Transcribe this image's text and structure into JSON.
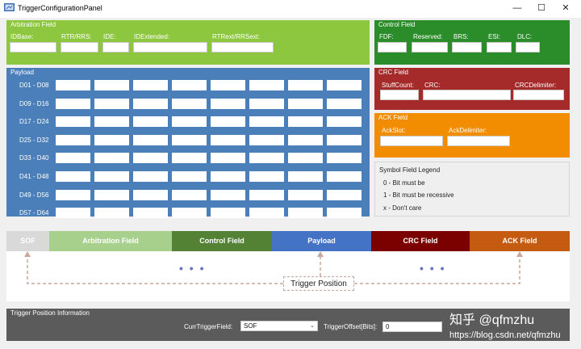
{
  "window": {
    "title": "TriggerConfigurationPanel",
    "minimize": "—",
    "maximize": "☐",
    "close": "✕"
  },
  "arbitration": {
    "title": "Arbitration Field",
    "color": "#8dc63f",
    "fields": [
      "IDBase:",
      "RTR/RRS:",
      "IDE:",
      "IDExtended:",
      "RTRext/RRSext:"
    ]
  },
  "control": {
    "title": "Control Field",
    "color": "#2a8d2a",
    "fields": [
      "FDF:",
      "Reserved:",
      "BRS:",
      "ESI:",
      "DLC:"
    ]
  },
  "payload": {
    "title": "Payload",
    "color": "#4a7fba",
    "rows": [
      "D01 - D08",
      "D09 - D16",
      "D17 - D24",
      "D25 - D32",
      "D33 - D40",
      "D41 - D48",
      "D49 - D56",
      "D57 - D64"
    ]
  },
  "crc": {
    "title": "CRC Field",
    "color": "#a52a2a",
    "fields": [
      "StuffCount:",
      "CRC:",
      "CRCDelimiter:"
    ]
  },
  "ack": {
    "title": "ACK Field",
    "color": "#f28c00",
    "fields": [
      "AckSlot:",
      "AckDelimiter:"
    ]
  },
  "legend": {
    "title": "Symbol Field Legend",
    "items": [
      "0 - Bit must be",
      "1 - Bit must be recessive",
      "x - Don't care"
    ]
  },
  "frame": {
    "segments": [
      {
        "label": "SOF",
        "bg": "#d9d9d9",
        "fg": "#ffffff"
      },
      {
        "label": "Arbitration Field",
        "bg": "#a8d08d",
        "fg": "#ffffff"
      },
      {
        "label": "Control Field",
        "bg": "#548235",
        "fg": "#ffffff"
      },
      {
        "label": "Payload",
        "bg": "#4472c4",
        "fg": "#ffffff"
      },
      {
        "label": "CRC Field",
        "bg": "#7b0000",
        "fg": "#ffffff"
      },
      {
        "label": "ACK Field",
        "bg": "#c55a11",
        "fg": "#ffffff"
      }
    ],
    "dots": "• • •",
    "trigger_position": "Trigger Position"
  },
  "trigger_info": {
    "title": "Trigger Position Information",
    "curr_label": "CurrTriggerField:",
    "curr_value": "SOF",
    "offset_label": "TriggerOffset[Bits]:",
    "offset_value": "0"
  },
  "watermark": {
    "brand": "知乎 @qfmzhu",
    "url": "https://blog.csdn.net/qfmzhu"
  }
}
